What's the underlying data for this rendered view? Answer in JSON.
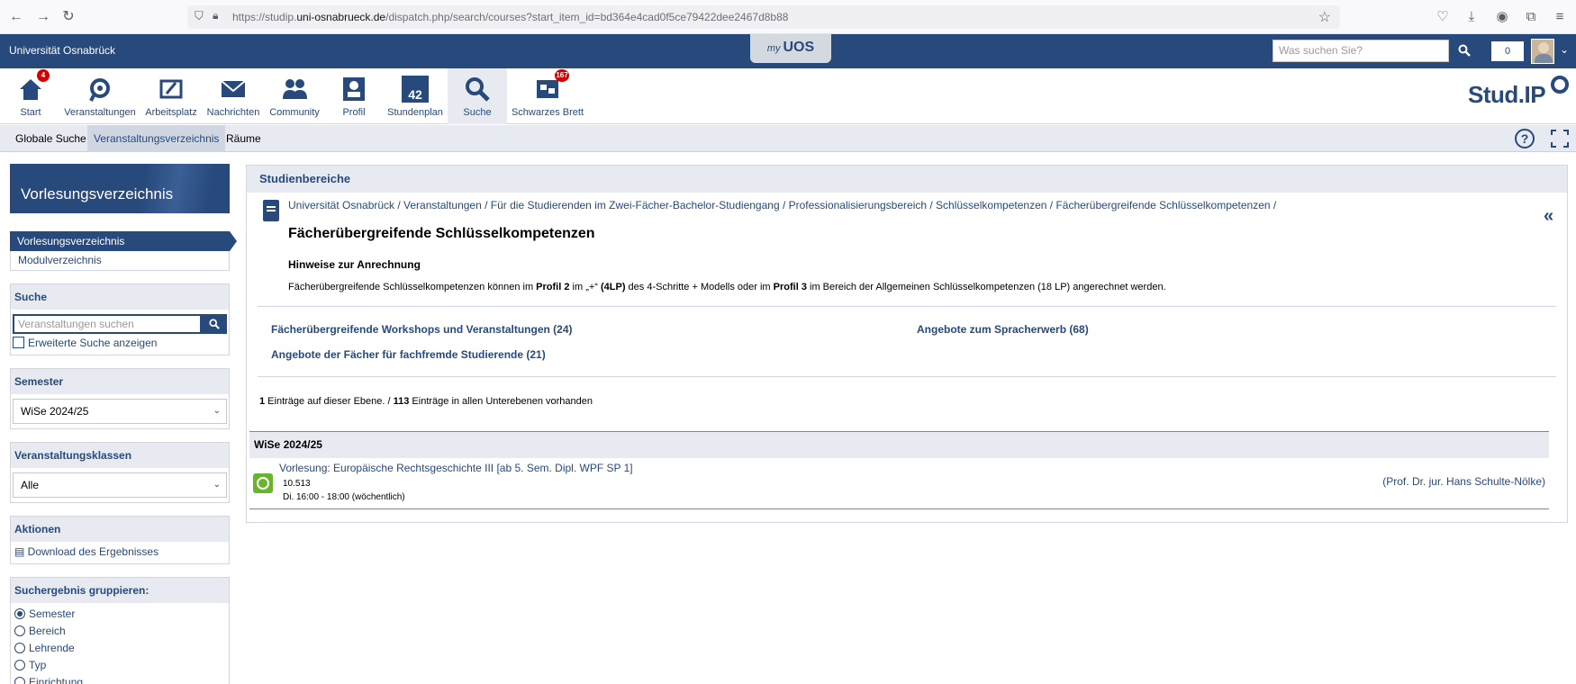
{
  "browser": {
    "back": "←",
    "forward": "→",
    "reload": "↻",
    "url_prefix": "https://studip.",
    "url_domain": "uni-osnabrueck.de",
    "url_path": "/dispatch.php/search/courses?start_item_id=bd364e4cad0f5ce79422dee2467d8b88"
  },
  "header": {
    "uni_name": "Universität Osnabrück",
    "myuos_my": "my",
    "myuos_uos": "UOS",
    "search_placeholder": "Was suchen Sie?",
    "notification_count": "0"
  },
  "nav": {
    "items": [
      {
        "label": "Start",
        "badge": "4"
      },
      {
        "label": "Veranstaltungen"
      },
      {
        "label": "Arbeitsplatz"
      },
      {
        "label": "Nachrichten"
      },
      {
        "label": "Community"
      },
      {
        "label": "Profil"
      },
      {
        "label": "Stundenplan",
        "icon_text": "42"
      },
      {
        "label": "Suche"
      },
      {
        "label": "Schwarzes Brett",
        "badge": "167"
      }
    ],
    "logo": "Stud.IP"
  },
  "subnav": {
    "tabs": [
      "Globale Suche",
      "Veranstaltungsverzeichnis",
      "Räume"
    ],
    "help": "?"
  },
  "sidebar": {
    "title": "Vorlesungsverzeichnis",
    "links": [
      "Vorlesungsverzeichnis",
      "Modulverzeichnis"
    ],
    "search": {
      "title": "Suche",
      "placeholder": "Veranstaltungen suchen",
      "advanced": "Erweiterte Suche anzeigen"
    },
    "semester": {
      "title": "Semester",
      "value": "WiSe 2024/25"
    },
    "classes": {
      "title": "Veranstaltungsklassen",
      "value": "Alle"
    },
    "actions": {
      "title": "Aktionen",
      "download": "Download des Ergebnisses"
    },
    "grouping": {
      "title": "Suchergebnis gruppieren:",
      "options": [
        "Semester",
        "Bereich",
        "Lehrende",
        "Typ",
        "Einrichtung"
      ]
    }
  },
  "content": {
    "section_title": "Studienbereiche",
    "breadcrumb": "Universität Osnabrück / Veranstaltungen / Für die Studierenden im Zwei-Fächer-Bachelor-Studiengang / Professionalisierungsbereich / Schlüsselkompetenzen / Fächerübergreifende Schlüsselkompetenzen /",
    "title": "Fächerübergreifende Schlüsselkompetenzen",
    "hint_title": "Hinweise zur Anrechnung",
    "hint_parts": {
      "p1": "Fächerübergreifende Schlüsselkompetenzen können im ",
      "b1": "Profil 2",
      "p2": " im „+“ ",
      "b2": "(4LP)",
      "p3": " des 4-Schritte + Modells oder im ",
      "b3": "Profil 3",
      "p4": " im Bereich der Allgemeinen Schlüsselkompetenzen (18 LP) angerechnet werden."
    },
    "areas": [
      "Fächerübergreifende Workshops und Veranstaltungen (24)",
      "Angebote zum Spracherwerb (68)",
      "Angebote der Fächer für fachfremde Studierende (21)"
    ],
    "counts": {
      "level_num": "1",
      "level_text": " Einträge auf dieser Ebene.   /  ",
      "sub_num": "113",
      "sub_text": " Einträge in allen Unterebenen vorhanden"
    },
    "semester": "WiSe 2024/25",
    "course": {
      "title": "Vorlesung: Europäische Rechtsgeschichte III [ab 5. Sem. Dipl. WPF SP 1]",
      "number": "10.513",
      "time": "Di. 16:00 - 18:00 (wöchentlich)",
      "lecturer": "(Prof. Dr. jur. Hans Schulte-Nölke)"
    }
  }
}
